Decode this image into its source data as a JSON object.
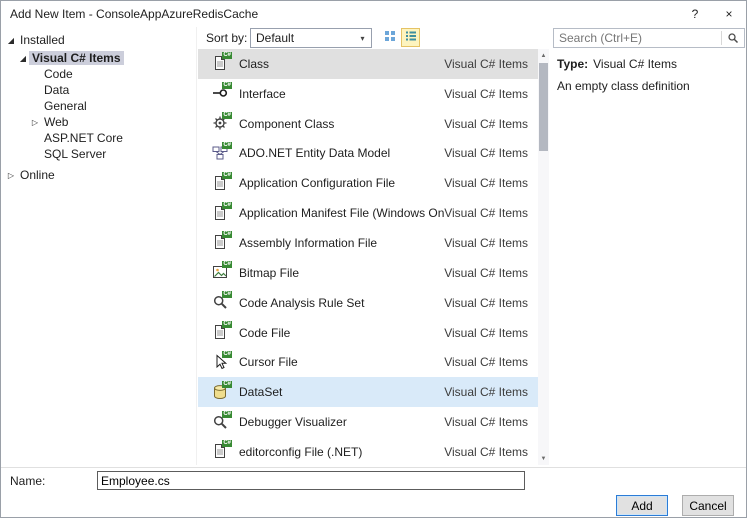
{
  "window": {
    "title": "Add New Item - ConsoleAppAzureRedisCache",
    "help_label": "?",
    "close_label": "×"
  },
  "icons": {
    "expanded_glyph": "◢",
    "collapsed_glyph": "▷",
    "combo_arrow": "▾",
    "scroll_up": "▲",
    "scroll_down": "▼",
    "badge": "C#"
  },
  "sidebar": {
    "items": [
      {
        "label": "Installed",
        "level": 0,
        "expanded": true
      },
      {
        "label": "Visual C# Items",
        "level": 1,
        "expanded": true,
        "selected": true
      },
      {
        "label": "Code",
        "level": 2
      },
      {
        "label": "Data",
        "level": 2
      },
      {
        "label": "General",
        "level": 2
      },
      {
        "label": "Web",
        "level": 2,
        "collapsed": true
      },
      {
        "label": "ASP.NET Core",
        "level": 2
      },
      {
        "label": "SQL Server",
        "level": 2
      },
      {
        "label": "Online",
        "level": 0,
        "collapsed": true
      }
    ]
  },
  "toolbar": {
    "sort_label": "Sort by:",
    "sort_value": "Default",
    "search_placeholder": "Search (Ctrl+E)"
  },
  "list": {
    "items": [
      {
        "name": "Class",
        "category": "Visual C# Items",
        "icon": "doc",
        "selected": true
      },
      {
        "name": "Interface",
        "category": "Visual C# Items",
        "icon": "interface"
      },
      {
        "name": "Component Class",
        "category": "Visual C# Items",
        "icon": "gear"
      },
      {
        "name": "ADO.NET Entity Data Model",
        "category": "Visual C# Items",
        "icon": "entity"
      },
      {
        "name": "Application Configuration File",
        "category": "Visual C# Items",
        "icon": "doc"
      },
      {
        "name": "Application Manifest File (Windows Only)",
        "category": "Visual C# Items",
        "icon": "doc"
      },
      {
        "name": "Assembly Information File",
        "category": "Visual C# Items",
        "icon": "doc"
      },
      {
        "name": "Bitmap File",
        "category": "Visual C# Items",
        "icon": "image"
      },
      {
        "name": "Code Analysis Rule Set",
        "category": "Visual C# Items",
        "icon": "magnifier"
      },
      {
        "name": "Code File",
        "category": "Visual C# Items",
        "icon": "doc"
      },
      {
        "name": "Cursor File",
        "category": "Visual C# Items",
        "icon": "cursor"
      },
      {
        "name": "DataSet",
        "category": "Visual C# Items",
        "icon": "db",
        "hovered": true
      },
      {
        "name": "Debugger Visualizer",
        "category": "Visual C# Items",
        "icon": "magnifier"
      },
      {
        "name": "editorconfig File (.NET)",
        "category": "Visual C# Items",
        "icon": "doc"
      }
    ]
  },
  "details": {
    "type_label": "Type:",
    "type_value": "Visual C# Items",
    "description": "An empty class definition"
  },
  "footer": {
    "name_label": "Name:",
    "name_value": "Employee.cs",
    "add_label": "Add",
    "cancel_label": "Cancel"
  }
}
